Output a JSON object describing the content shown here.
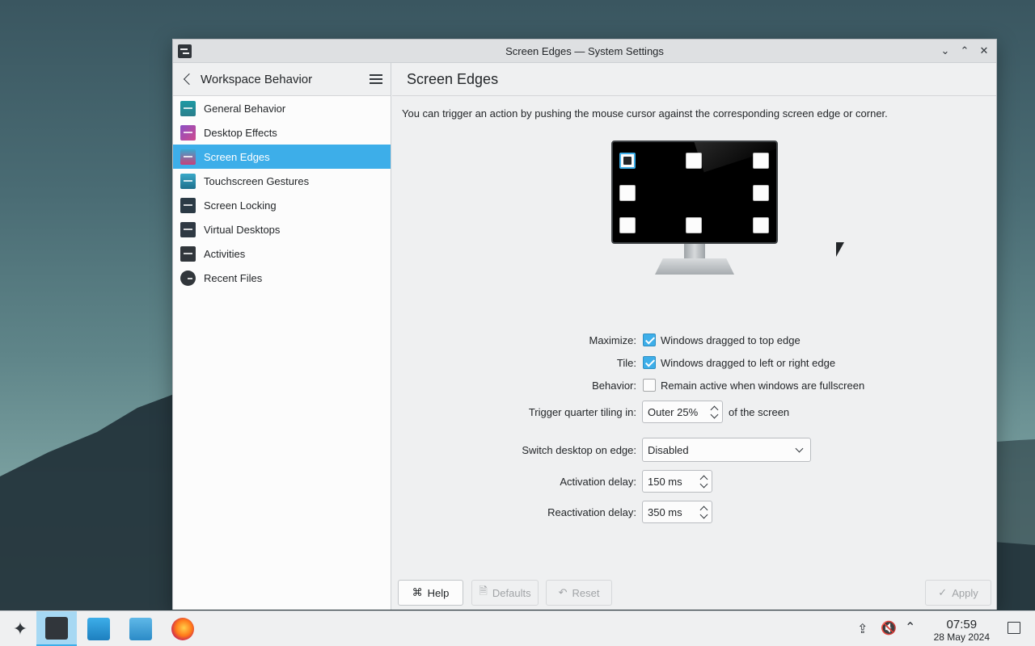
{
  "window": {
    "title": "Screen Edges — System Settings"
  },
  "sidebar": {
    "title": "Workspace Behavior",
    "items": [
      {
        "label": "General Behavior",
        "icon": "general-behavior-icon"
      },
      {
        "label": "Desktop Effects",
        "icon": "desktop-effects-icon"
      },
      {
        "label": "Screen Edges",
        "icon": "screen-edges-icon",
        "active": true
      },
      {
        "label": "Touchscreen Gestures",
        "icon": "touchscreen-icon"
      },
      {
        "label": "Screen Locking",
        "icon": "lock-icon"
      },
      {
        "label": "Virtual Desktops",
        "icon": "virtual-desktops-icon"
      },
      {
        "label": "Activities",
        "icon": "activities-icon"
      },
      {
        "label": "Recent Files",
        "icon": "recent-files-icon"
      }
    ]
  },
  "content": {
    "title": "Screen Edges",
    "description": "You can trigger an action by pushing the mouse cursor against the corresponding screen edge or corner.",
    "maximize": {
      "label": "Maximize:",
      "text": "Windows dragged to top edge",
      "checked": true
    },
    "tile": {
      "label": "Tile:",
      "text": "Windows dragged to left or right edge",
      "checked": true
    },
    "behavior": {
      "label": "Behavior:",
      "text": "Remain active when windows are fullscreen",
      "checked": false
    },
    "quarter_tiling": {
      "label": "Trigger quarter tiling in:",
      "value": "Outer 25%",
      "suffix": "of the screen"
    },
    "switch_desktop": {
      "label": "Switch desktop on edge:",
      "value": "Disabled"
    },
    "activation_delay": {
      "label": "Activation delay:",
      "value": "150 ms"
    },
    "reactivation_delay": {
      "label": "Reactivation delay:",
      "value": "350 ms"
    }
  },
  "footer": {
    "help": "Help",
    "defaults": "Defaults",
    "reset": "Reset",
    "apply": "Apply"
  },
  "taskbar": {
    "time": "07:59",
    "date": "28 May 2024"
  },
  "colors": {
    "accent": "#3daee9",
    "window_bg": "#eff0f1"
  }
}
